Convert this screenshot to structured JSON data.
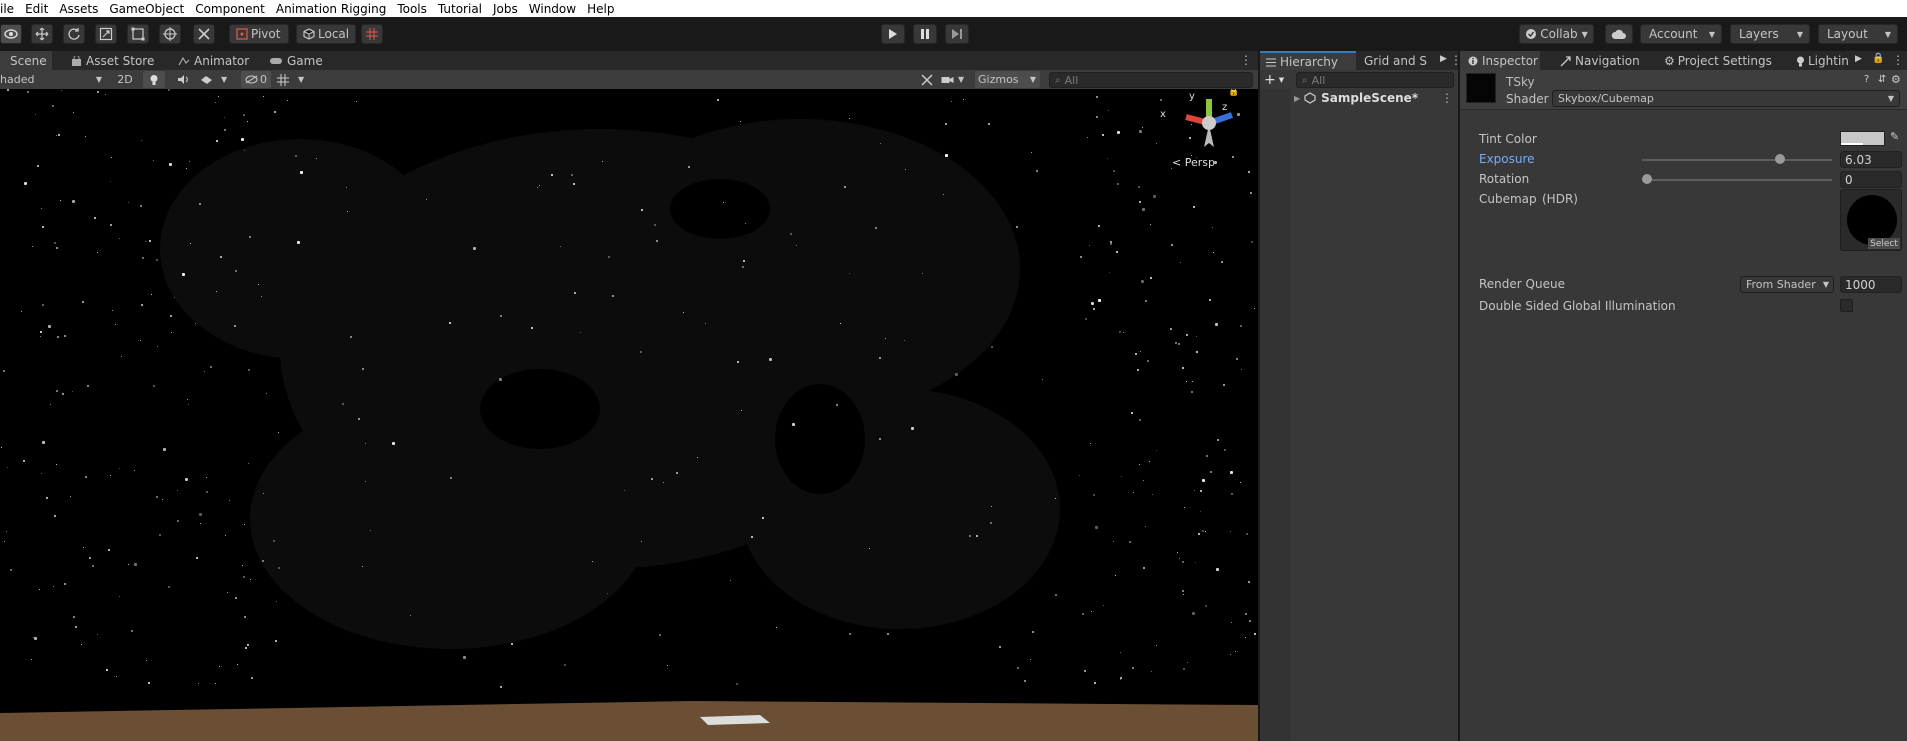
{
  "menu": [
    "ile",
    "Edit",
    "Assets",
    "GameObject",
    "Component",
    "Animation Rigging",
    "Tools",
    "Tutorial",
    "Jobs",
    "Window",
    "Help"
  ],
  "toolbar": {
    "pivot": "Pivot",
    "local": "Local",
    "collab": "Collab",
    "account": "Account",
    "layers": "Layers",
    "layout": "Layout"
  },
  "scene": {
    "tabs": [
      "Scene",
      "Asset Store",
      "Animator",
      "Game"
    ],
    "shading": "haded",
    "mode_2d": "2D",
    "hidden_count": "0",
    "gizmos": "Gizmos",
    "search_placeholder": "All",
    "gizmo_axes": {
      "x": "x",
      "y": "y",
      "z": "z"
    },
    "projection": "Persp"
  },
  "hierarchy": {
    "tabs": [
      "Hierarchy",
      "Grid and S"
    ],
    "search_placeholder": "All",
    "root_item": "SampleScene*"
  },
  "inspector": {
    "tabs": [
      "Inspector",
      "Navigation",
      "Project Settings",
      "Lightin"
    ],
    "material_name": "TSky",
    "shader_label": "Shader",
    "shader_value": "Skybox/Cubemap",
    "props": {
      "tint_color": "Tint Color",
      "exposure": "Exposure",
      "exposure_value": "6.03",
      "exposure_fraction": 0.74,
      "rotation": "Rotation",
      "rotation_value": "0",
      "rotation_fraction": 0.0,
      "cubemap": "Cubemap",
      "hdr": "(HDR)",
      "select": "Select",
      "render_queue": "Render Queue",
      "render_queue_mode": "From Shader",
      "render_queue_value": "1000",
      "double_sided_gi": "Double Sided Global Illumination"
    }
  },
  "colors": {
    "accent_blue": "#7baaf7",
    "panel": "#383838",
    "viewport": "#000000",
    "ground": "#6b4f34"
  }
}
